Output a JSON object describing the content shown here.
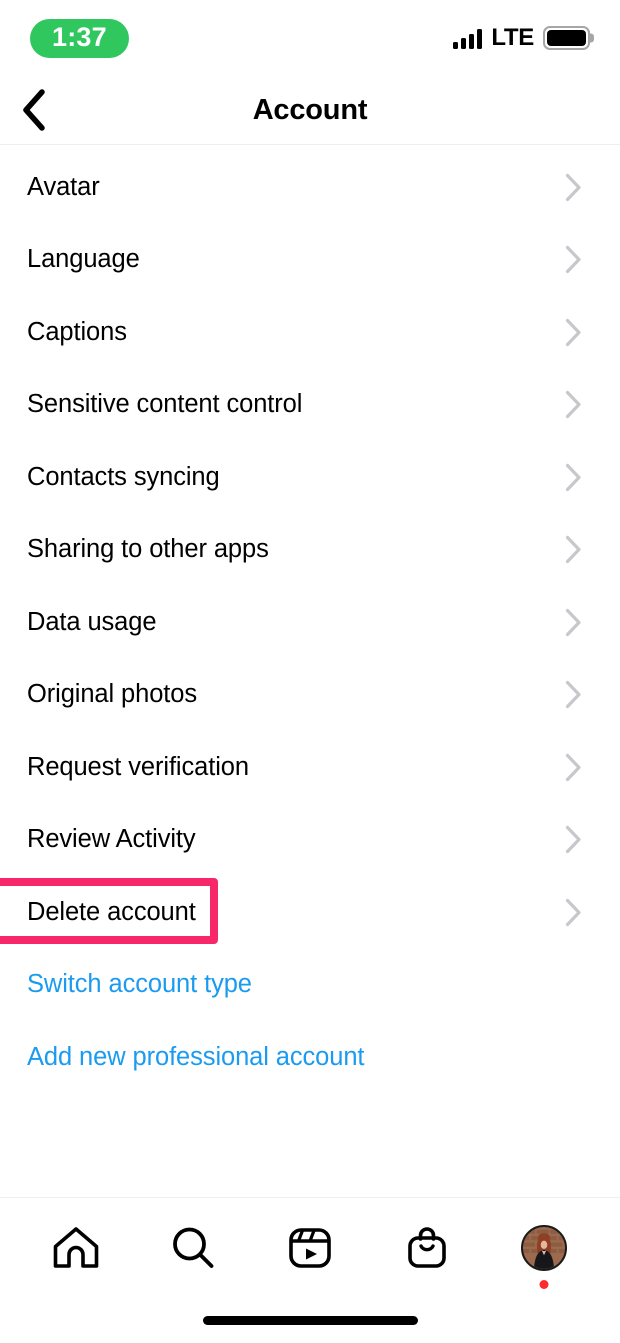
{
  "status_bar": {
    "time": "1:37",
    "time_pill_color": "#30C75E",
    "network_label": "LTE",
    "signal_icon": "signal-bars-icon",
    "battery_icon": "battery-full-icon",
    "battery_level_percent": 100
  },
  "header": {
    "back_icon": "chevron-left-icon",
    "title": "Account"
  },
  "settings_list": {
    "chevron_icon": "chevron-right-icon",
    "chevron_color": "#C7C7CC",
    "items": [
      {
        "label": "Avatar"
      },
      {
        "label": "Language"
      },
      {
        "label": "Captions"
      },
      {
        "label": "Sensitive content control"
      },
      {
        "label": "Contacts syncing"
      },
      {
        "label": "Sharing to other apps"
      },
      {
        "label": "Data usage"
      },
      {
        "label": "Original photos"
      },
      {
        "label": "Request verification"
      },
      {
        "label": "Review Activity"
      },
      {
        "label": "Delete account",
        "highlighted": true
      }
    ]
  },
  "links": {
    "color": "#1A9BF0",
    "items": [
      {
        "label": "Switch account type"
      },
      {
        "label": "Add new professional account"
      }
    ]
  },
  "highlight": {
    "target_label": "Delete account",
    "border_color": "#F8276A"
  },
  "tab_bar": {
    "tabs": [
      {
        "name": "home",
        "icon": "home-icon"
      },
      {
        "name": "search",
        "icon": "search-icon"
      },
      {
        "name": "reels",
        "icon": "reels-icon"
      },
      {
        "name": "shop",
        "icon": "shopping-bag-icon"
      },
      {
        "name": "profile",
        "icon": "avatar-icon",
        "badge": true,
        "badge_color": "#FF2A2A"
      }
    ]
  },
  "home_indicator": {
    "icon": "home-indicator-bar"
  }
}
